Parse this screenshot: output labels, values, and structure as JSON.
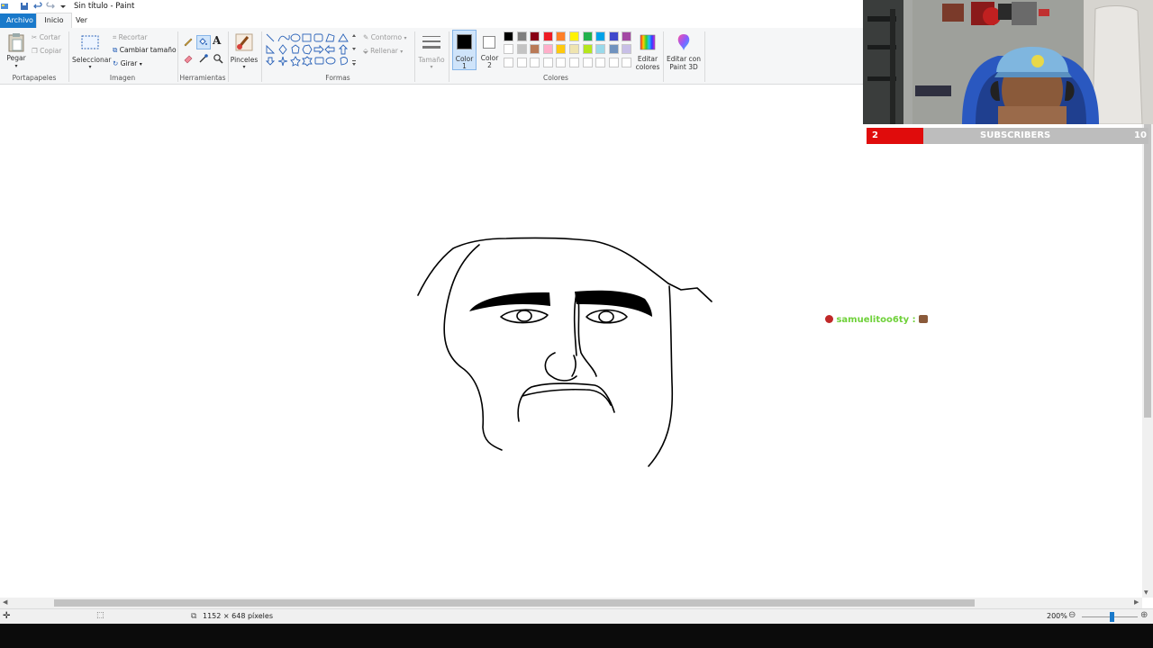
{
  "window": {
    "title": "Sin título - Paint"
  },
  "tabs": [
    {
      "label": "Archivo"
    },
    {
      "label": "Inicio"
    },
    {
      "label": "Ver"
    }
  ],
  "ribbon": {
    "clipboard": {
      "paste": "Pegar",
      "cut": "Cortar",
      "copy": "Copiar",
      "group": "Portapapeles"
    },
    "image": {
      "select": "Seleccionar",
      "crop": "Recortar",
      "resize": "Cambiar tamaño",
      "rotate": "Girar",
      "group": "Imagen"
    },
    "tools": {
      "group": "Herramientas",
      "brushes": "Pinceles"
    },
    "shapes": {
      "group": "Formas",
      "outline": "Contorno",
      "fill": "Rellenar"
    },
    "size": "Tamaño",
    "color1": {
      "line1": "Color",
      "line2": "1"
    },
    "color2": {
      "line1": "Color",
      "line2": "2"
    },
    "colors": {
      "group": "Colores",
      "row1": [
        "#000000",
        "#7f7f7f",
        "#880015",
        "#ed1c24",
        "#ff7f27",
        "#fff200",
        "#22b14c",
        "#00a2e8",
        "#3f48cc",
        "#a349a4"
      ],
      "row2": [
        "#ffffff",
        "#c3c3c3",
        "#b97a57",
        "#ffaec9",
        "#ffc90e",
        "#efe4b0",
        "#b5e61d",
        "#99d9ea",
        "#7092be",
        "#c8bfe7"
      ],
      "active_color1": "#000000",
      "active_color2": "#ffffff"
    },
    "edit_colors": {
      "line1": "Editar",
      "line2": "colores"
    },
    "paint3d": {
      "line1": "Editar con",
      "line2": "Paint 3D"
    }
  },
  "status": {
    "size": "1152 × 648 píxeles",
    "zoom": "200%"
  },
  "overlay": {
    "subscribers": {
      "label": "SUBSCRIBERS",
      "current": "2",
      "goal": "10",
      "progress": 0.2
    },
    "chat": {
      "user": "samuelitoo6ty :"
    }
  }
}
